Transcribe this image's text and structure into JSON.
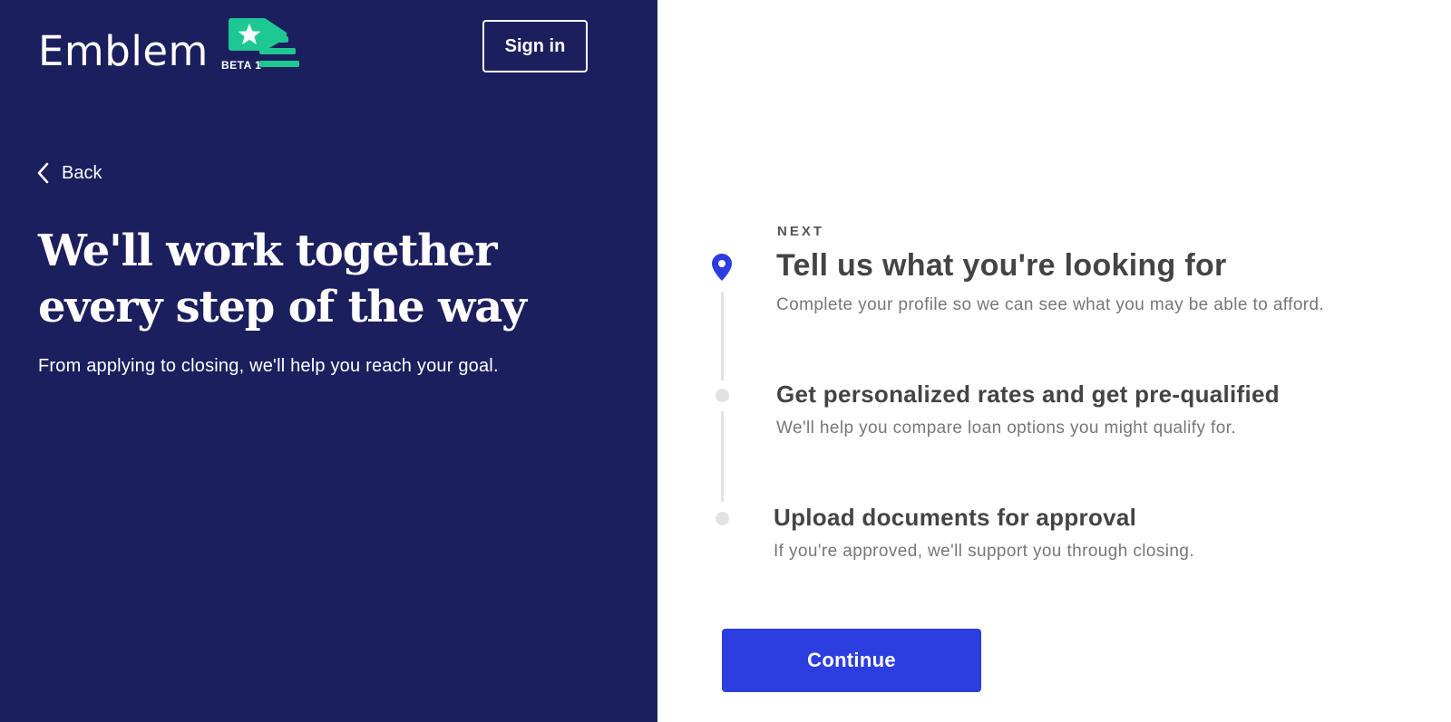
{
  "brand": {
    "name": "Emblem",
    "badge": "BETA 1",
    "accent_color": "#1ec892",
    "panel_color": "#1c1f5e"
  },
  "header": {
    "signin_label": "Sign in"
  },
  "nav": {
    "back_label": "Back",
    "back_icon": "chevron-left-icon"
  },
  "hero": {
    "headline": "We'll work together every step of the way",
    "subline": "From applying to closing, we'll help you reach your goal."
  },
  "steps": {
    "next_label": "NEXT",
    "current_icon": "location-pin-icon",
    "items": [
      {
        "title": "Tell us what you're looking for",
        "description": "Complete your profile so we can see what you may be able to afford."
      },
      {
        "title": "Get personalized rates and get pre-qualified",
        "description": "We'll help you compare loan options you might qualify for."
      },
      {
        "title": "Upload documents for approval",
        "description": "If you're approved, we'll support you through closing."
      }
    ]
  },
  "actions": {
    "continue_label": "Continue",
    "continue_color": "#2c3ee0"
  }
}
